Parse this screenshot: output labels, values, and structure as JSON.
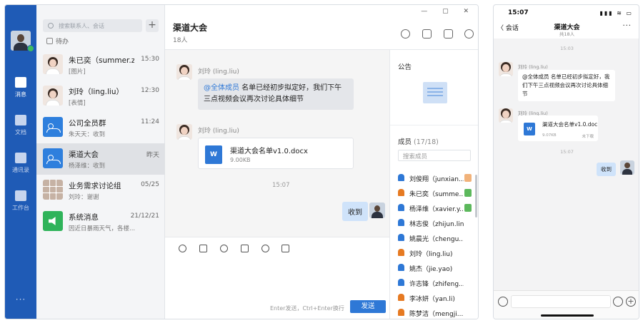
{
  "nav": {
    "items": [
      {
        "label": "消息",
        "icon": "message-icon",
        "active": true
      },
      {
        "label": "文档",
        "icon": "document-icon",
        "active": false
      },
      {
        "label": "通讯录",
        "icon": "contacts-icon",
        "active": false
      },
      {
        "label": "工作台",
        "icon": "workbench-icon",
        "active": false
      }
    ],
    "more": "···"
  },
  "list": {
    "search_placeholder": "搜索联系人、会话",
    "add": "+",
    "todo": "待办",
    "conversations": [
      {
        "title": "朱已奕（summer.z...",
        "time": "15:30",
        "preview": "[图片]",
        "avatar": "person"
      },
      {
        "title": "刘玲（ling.liu）",
        "time": "12:30",
        "preview": "[表情]",
        "avatar": "person"
      },
      {
        "title": "公司全员群",
        "time": "11:24",
        "preview": "朱天天：收到",
        "avatar": "group"
      },
      {
        "title": "渠道大会",
        "time": "昨天",
        "preview": "杨泽维：收到",
        "avatar": "group",
        "selected": true
      },
      {
        "title": "业务需求讨论组",
        "time": "05/25",
        "preview": "刘玲：谢谢",
        "avatar": "multi"
      },
      {
        "title": "系统消息",
        "time": "21/12/21",
        "preview": "因近日暴雨天气，各楼...",
        "avatar": "system"
      }
    ]
  },
  "chat": {
    "window_controls": "—  ▢  ✕",
    "title": "渠道大会",
    "member_count": "18人",
    "messages": {
      "m1_sender": "刘玲 (ling.liu)",
      "m1_mention": "@全体成员",
      "m1_text": " 名单已经初步拟定好，我们下午三点视频会议再次讨论具体细节",
      "m2_sender": "刘玲 (ling.liu)",
      "file_icon": "W",
      "file_name": "渠道大会名单v1.0.docx",
      "file_size": "9.00KB",
      "time": "15:07",
      "my_text": "收到"
    },
    "hint": "Enter发送，Ctrl+Enter换行",
    "send": "发送"
  },
  "panel": {
    "announce": "公告",
    "members_label": "成员",
    "members_count": "(17/18)",
    "search_placeholder": "搜索成员",
    "members": [
      {
        "name": "刘俊翔（junxian...",
        "color": "blue",
        "badge": "orange"
      },
      {
        "name": "朱已奕（summe...",
        "color": "orange",
        "badge": "green"
      },
      {
        "name": "杨泽维（xavier.y...",
        "color": "blue",
        "badge": "green"
      },
      {
        "name": "林志俊（zhijun.lin)",
        "color": "blue",
        "badge": ""
      },
      {
        "name": "姚晨光（chengu...",
        "color": "blue",
        "badge": ""
      },
      {
        "name": "刘玲（ling.liu)",
        "color": "orange",
        "badge": ""
      },
      {
        "name": "姚杰（jie.yao)",
        "color": "blue",
        "badge": ""
      },
      {
        "name": "许志锋（zhifeng...",
        "color": "blue",
        "badge": ""
      },
      {
        "name": "李冰妍（yan.li)",
        "color": "orange",
        "badge": ""
      },
      {
        "name": "陈梦洁（mengji...",
        "color": "orange",
        "badge": ""
      }
    ]
  },
  "phone": {
    "time": "15:07",
    "status": "▮▮▮ ≋ ▭",
    "back": "〈 会话",
    "title": "渠道大会",
    "subtitle": "共18人",
    "more": "···",
    "time1": "15:03",
    "sender1": "刘玲 (ling.liu)",
    "msg1": "@全体成员 名单已经初步拟定好，我们下午三点视频会议再次讨论具体细节",
    "sender2": "刘玲 (ling.liu)",
    "file_icon": "W",
    "file_name": "渠道大会名单v1.0.doc",
    "file_size": "9.07KB",
    "file_tag": "未下载",
    "time2": "15:07",
    "my_text": "收到",
    "plus": "+"
  }
}
